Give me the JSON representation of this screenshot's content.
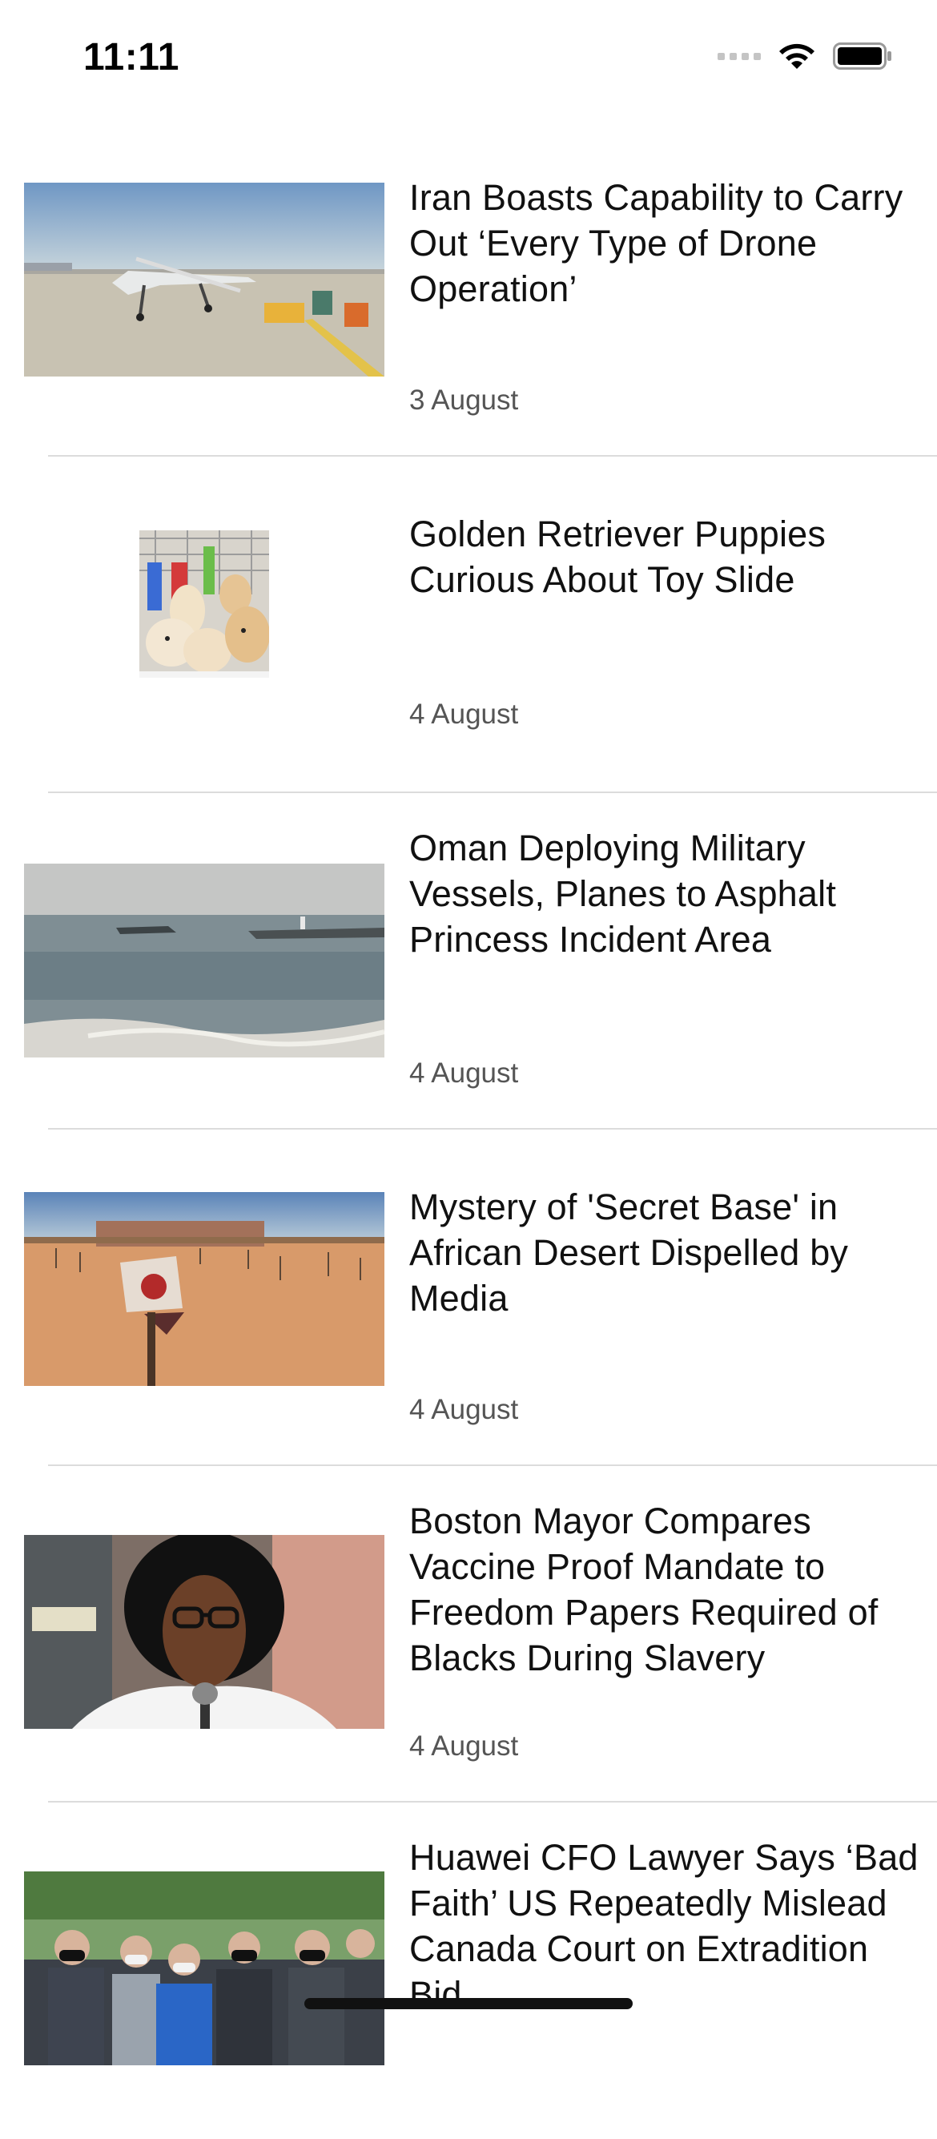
{
  "status_bar": {
    "time": "11:11",
    "icons": [
      "cellular-signal-icon",
      "wifi-icon",
      "battery-icon"
    ]
  },
  "articles": [
    {
      "title": "Iran Boasts Capability to Carry Out ‘Every Type of Drone Operation’",
      "date": "3 August",
      "thumbnail": "drone-photo"
    },
    {
      "title": "Golden Retriever Puppies Curious About Toy Slide",
      "date": "4 August",
      "thumbnail": "puppies-photo"
    },
    {
      "title": "Oman Deploying Military Vessels, Planes to Asphalt Princess Incident Area",
      "date": "4 August",
      "thumbnail": "sea-photo"
    },
    {
      "title": "Mystery of 'Secret Base' in African Desert Dispelled by Media",
      "date": "4 August",
      "thumbnail": "desert-photo"
    },
    {
      "title": "Boston Mayor Compares Vaccine Proof Mandate to Freedom Papers Required of Blacks During Slavery",
      "date": "4 August",
      "thumbnail": "mayor-photo"
    },
    {
      "title": "Huawei CFO Lawyer Says ‘Bad Faith’ US Repeatedly Mislead Canada Court on Extradition Bid",
      "date": "",
      "thumbnail": "crowd-photo"
    }
  ]
}
